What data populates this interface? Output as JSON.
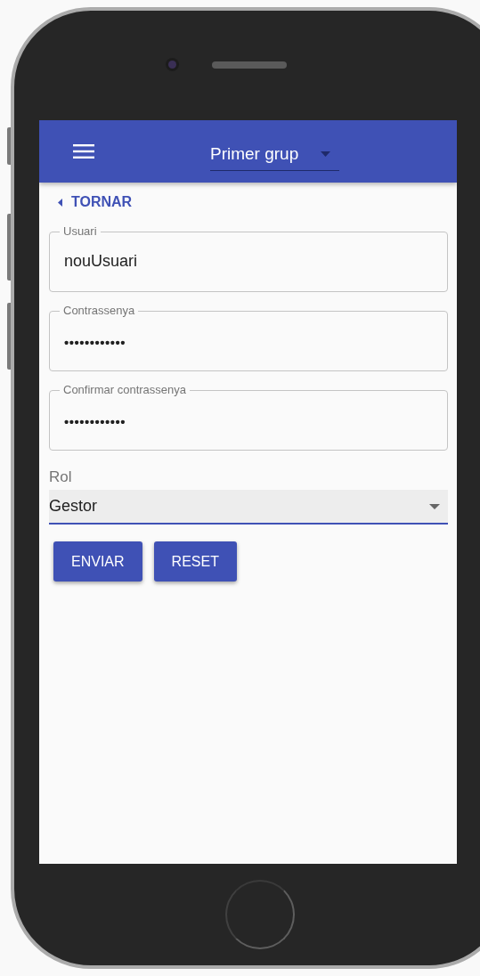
{
  "app_bar": {
    "group_select": {
      "value": "Primer grup"
    }
  },
  "back_link": {
    "label": "TORNAR"
  },
  "fields": [
    {
      "label": "Usuari",
      "value": "nouUsuari",
      "kind": "text"
    },
    {
      "label": "Contrassenya",
      "value": "••••••••••••",
      "kind": "password"
    },
    {
      "label": "Confirmar contrassenya",
      "value": "••••••••••••",
      "kind": "password"
    }
  ],
  "role_select": {
    "label": "Rol",
    "value": "Gestor"
  },
  "buttons": [
    "ENVIAR",
    "RESET"
  ]
}
